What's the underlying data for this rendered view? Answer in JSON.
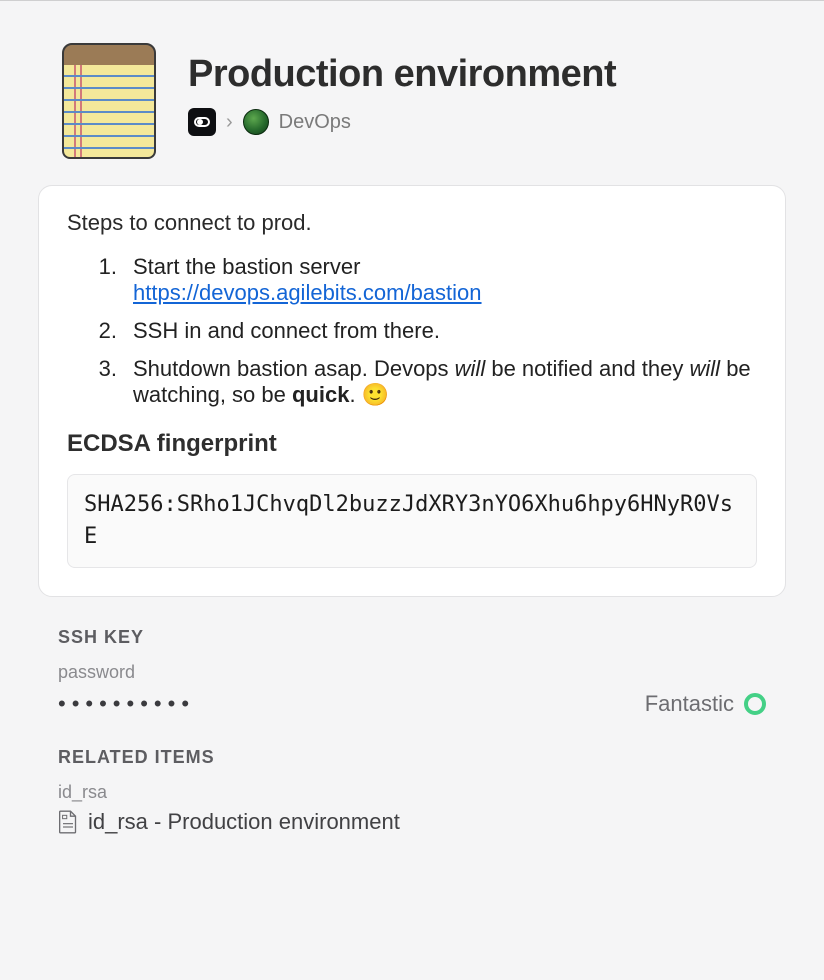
{
  "header": {
    "title": "Production environment",
    "breadcrumb": {
      "vault_name": "DevOps"
    }
  },
  "note": {
    "intro": "Steps to connect to prod.",
    "steps": [
      {
        "num": "1.",
        "text_before": "Start the bastion server ",
        "link_text": "https://devops.agilebits.com/bastion"
      },
      {
        "num": "2.",
        "text": "SSH in and connect from there."
      },
      {
        "num": "3.",
        "seg1": "Shutdown bastion asap. Devops ",
        "will1": "will",
        "seg2": " be notified and they ",
        "will2": "will",
        "seg3": " be watching, so be ",
        "quick": "quick",
        "seg4": ". ",
        "emoji": "🙂"
      }
    ],
    "fingerprint_heading": "ECDSA fingerprint",
    "fingerprint_value": "SHA256:SRho1JChvqDl2buzzJdXRY3nYO6Xhu6hpy6HNyR0VsE"
  },
  "sections": {
    "ssh": {
      "title": "SSH KEY",
      "field_label": "password",
      "masked": "••••••••••",
      "strength_label": "Fantastic"
    },
    "related": {
      "title": "RELATED ITEMS",
      "group_label": "id_rsa",
      "item_text": "id_rsa - Production environment"
    }
  }
}
